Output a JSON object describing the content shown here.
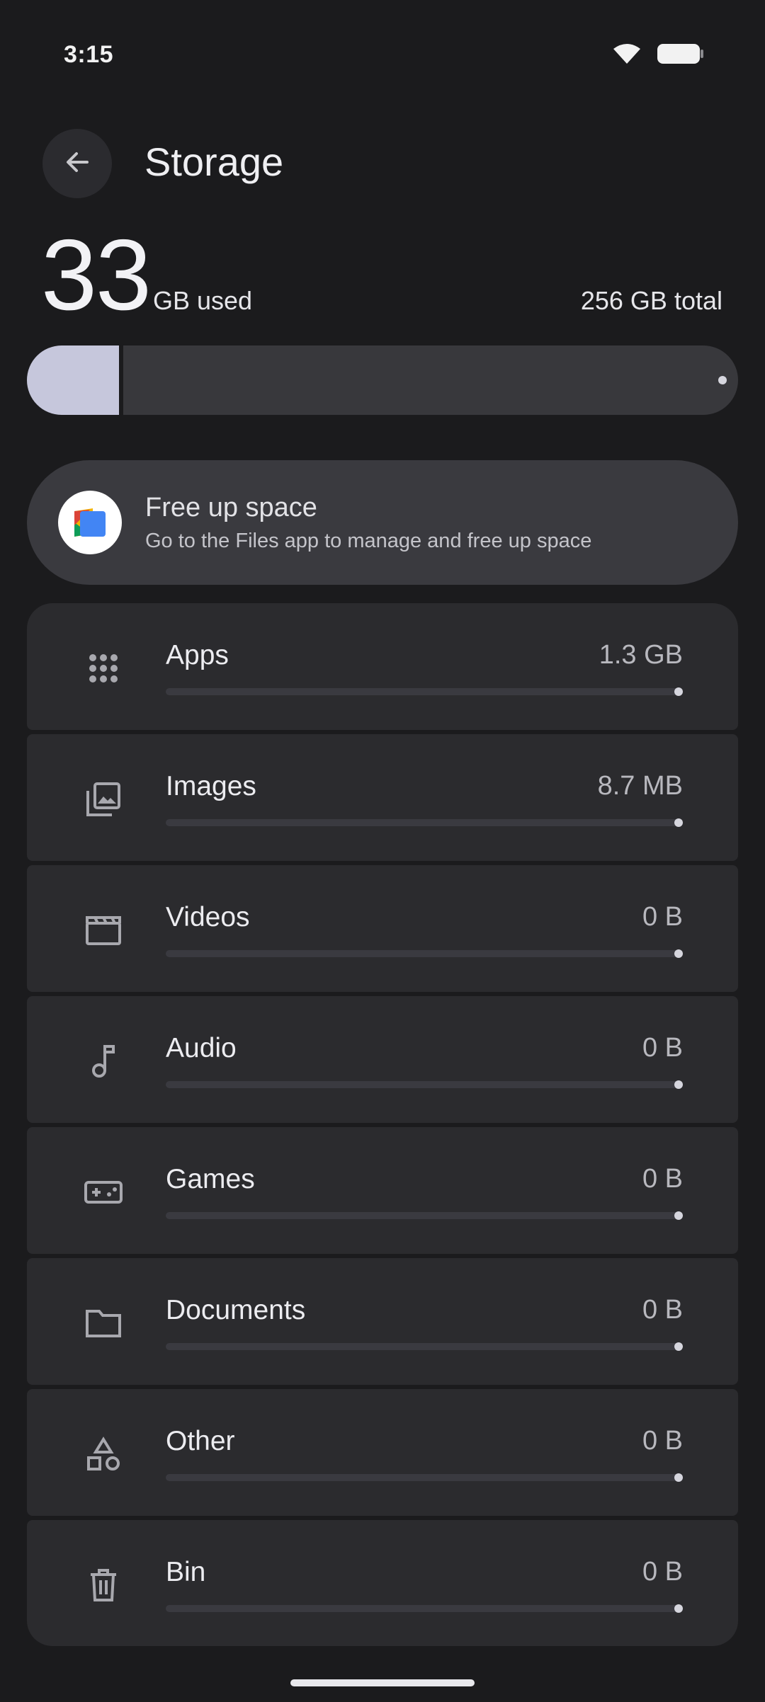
{
  "status_bar": {
    "time": "3:15",
    "icons": [
      "wifi-icon",
      "battery-icon"
    ]
  },
  "header": {
    "back_icon": "arrow-back-icon",
    "title": "Storage"
  },
  "summary": {
    "used_value": "33",
    "used_unit": "GB used",
    "total": "256 GB total",
    "used_fraction": 0.129
  },
  "free_up": {
    "icon": "files-app-icon",
    "title": "Free up space",
    "description": "Go to the Files app to manage and free up space"
  },
  "categories": [
    {
      "label": "Apps",
      "size": "1.3 GB",
      "icon": "apps-grid-icon",
      "fraction": 0.0
    },
    {
      "label": "Images",
      "size": "8.7 MB",
      "icon": "images-icon",
      "fraction": 0.0
    },
    {
      "label": "Videos",
      "size": "0 B",
      "icon": "videos-clapper-icon",
      "fraction": 0.0
    },
    {
      "label": "Audio",
      "size": "0 B",
      "icon": "music-note-icon",
      "fraction": 0.0
    },
    {
      "label": "Games",
      "size": "0 B",
      "icon": "gamepad-icon",
      "fraction": 0.0
    },
    {
      "label": "Documents",
      "size": "0 B",
      "icon": "folder-icon",
      "fraction": 0.0
    },
    {
      "label": "Other",
      "size": "0 B",
      "icon": "shapes-icon",
      "fraction": 0.0
    },
    {
      "label": "Bin",
      "size": "0 B",
      "icon": "trash-icon",
      "fraction": 0.0
    }
  ],
  "colors": {
    "background": "#1b1b1d",
    "usage_fill": "#c6c7dc",
    "card": "#2b2b2e",
    "accent_card": "#3a3a3f"
  }
}
